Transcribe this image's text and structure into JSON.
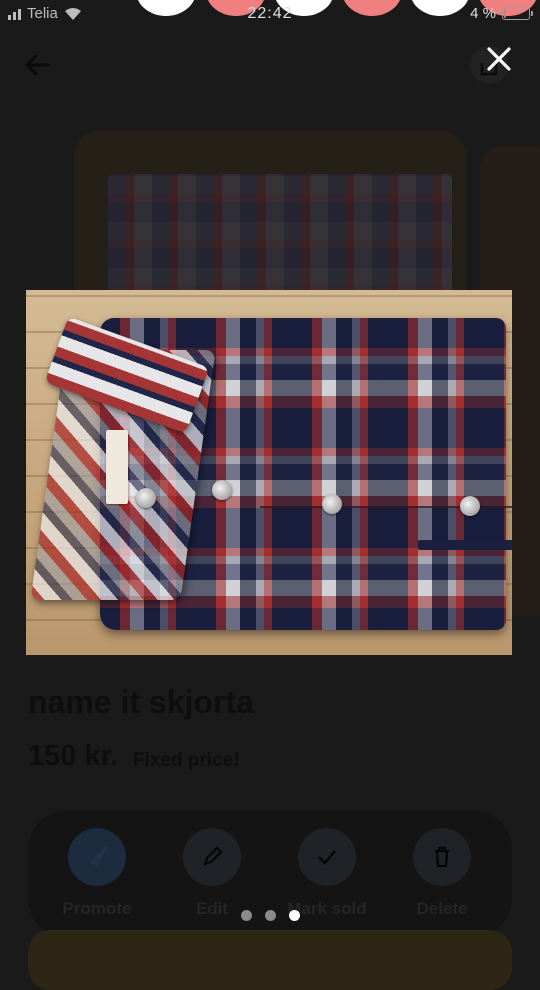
{
  "status_bar": {
    "carrier": "Telia",
    "time": "22:42",
    "battery_percent": "4 %",
    "battery_level": 0.04,
    "battery_color": "#e57373"
  },
  "header": {
    "back_icon": "arrow-left-icon",
    "share_icon": "share-icon",
    "close_icon": "close-icon"
  },
  "listing": {
    "title": "name it skjorta",
    "price": "150 kr.",
    "price_note": "Fixed price!",
    "actions": [
      {
        "label": "Promote",
        "icon": "rocket-icon"
      },
      {
        "label": "Edit",
        "icon": "pencil-icon"
      },
      {
        "label": "Mark sold",
        "icon": "checkmark-icon"
      },
      {
        "label": "Delete",
        "icon": "trash-icon"
      }
    ]
  },
  "viewer": {
    "total_images": 3,
    "current_image": 3,
    "photo_subject": "folded plaid shirt on wooden floor"
  },
  "colors": {
    "overlay": "#1a1a1a",
    "dot_active": "#ffffff",
    "dot_inactive": "#8a8a8a"
  }
}
